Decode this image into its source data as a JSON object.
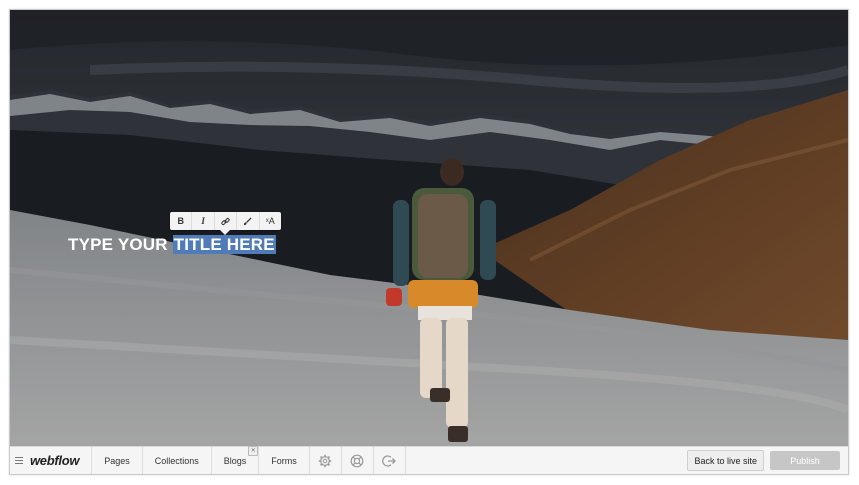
{
  "editor": {
    "format_toolbar": {
      "bold": "B",
      "italic": "I",
      "link": "link-icon",
      "color": "brush-icon",
      "clear": "ˣA"
    },
    "hero": {
      "title_prefix": "TYPE YOUR ",
      "title_selected": "TITLE HERE"
    }
  },
  "bottombar": {
    "brand": "webflow",
    "nav": {
      "pages": "Pages",
      "collections": "Collections",
      "blogs": "Blogs",
      "blogs_badge": "✕",
      "forms": "Forms"
    },
    "icons": [
      "settings-icon",
      "help-icon",
      "logout-icon"
    ],
    "back_to_live": "Back to live site",
    "publish": "Publish"
  },
  "colors": {
    "selection": "#4f7cb8",
    "bar_bg": "#f5f5f5",
    "publish_bg": "#c6c6c6"
  }
}
